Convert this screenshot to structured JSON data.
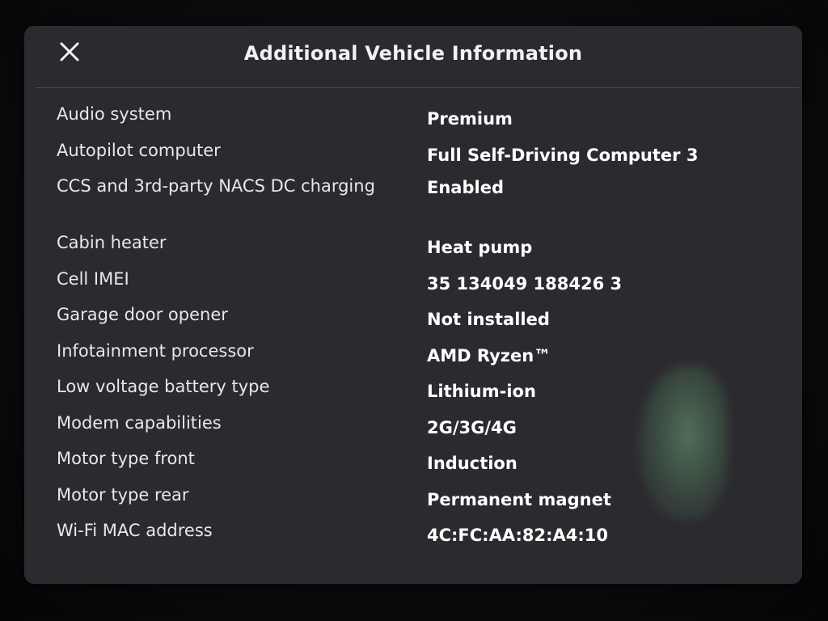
{
  "dialog": {
    "title": "Additional Vehicle Information",
    "close_icon": "close-icon"
  },
  "colors": {
    "background": "#2b2a2f",
    "text": "#ffffff",
    "divider": "#4a4950"
  },
  "rows": [
    {
      "label": "Audio system",
      "value": "Premium"
    },
    {
      "label": "Autopilot computer",
      "value": "Full Self-Driving Computer 3"
    },
    {
      "label": "CCS and 3rd-party NACS DC charging",
      "value": "Enabled"
    },
    {
      "label": "Cabin heater",
      "value": "Heat pump"
    },
    {
      "label": "Cell IMEI",
      "value": "35 134049 188426 3"
    },
    {
      "label": "Garage door opener",
      "value": "Not installed"
    },
    {
      "label": "Infotainment processor",
      "value": "AMD Ryzen™"
    },
    {
      "label": "Low voltage battery type",
      "value": "Lithium-ion"
    },
    {
      "label": "Modem capabilities",
      "value": "2G/3G/4G"
    },
    {
      "label": "Motor type front",
      "value": "Induction"
    },
    {
      "label": "Motor type rear",
      "value": "Permanent magnet"
    },
    {
      "label": "Wi-Fi MAC address",
      "value": "4C:FC:AA:82:A4:10"
    }
  ]
}
